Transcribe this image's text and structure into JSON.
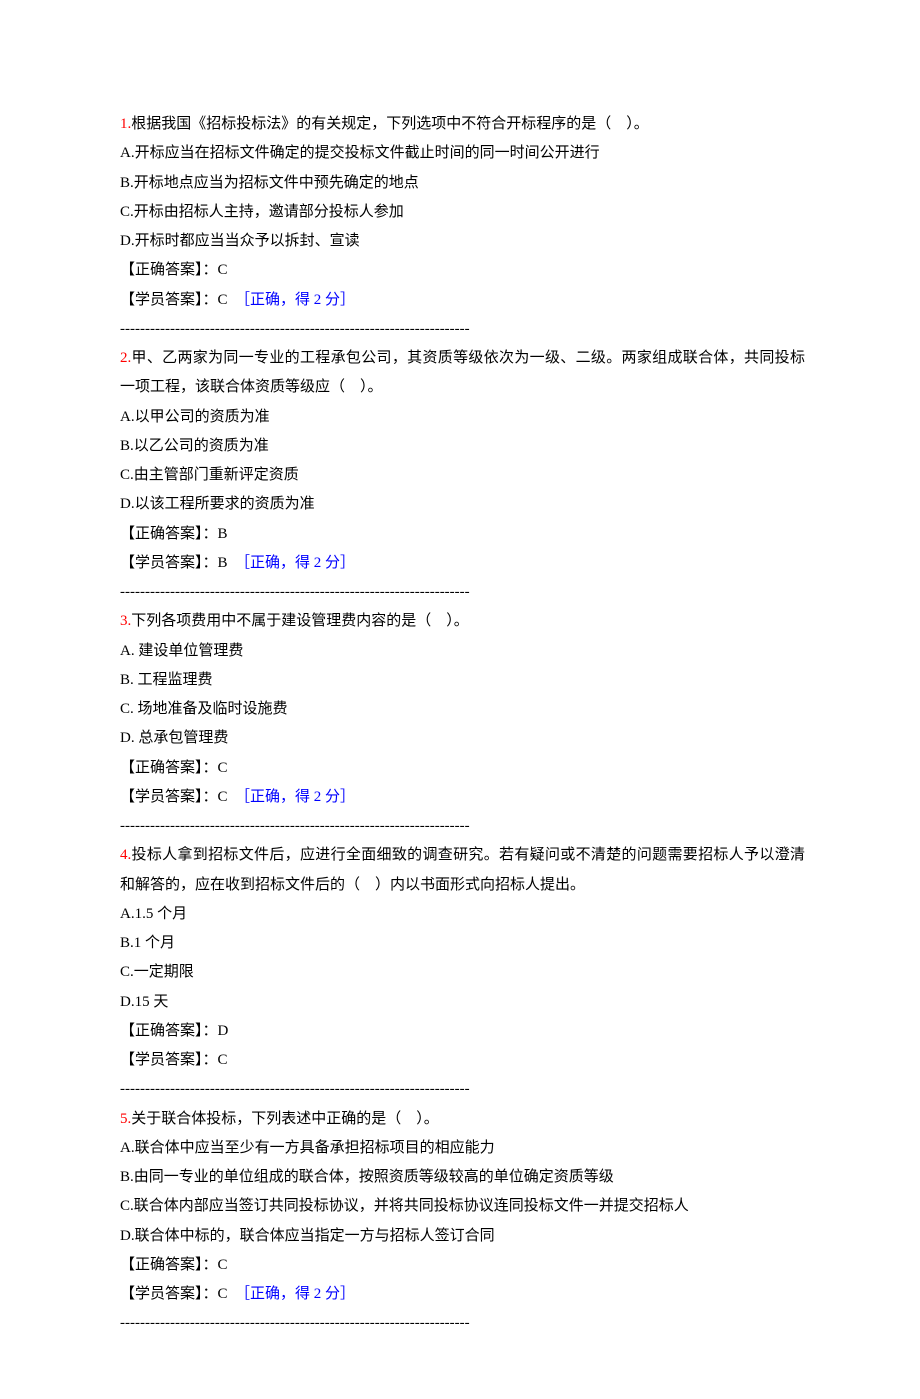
{
  "divider": "----------------------------------------------------------------------",
  "labels": {
    "correct_answer": "【正确答案】：",
    "student_answer": "【学员答案】：",
    "feedback_correct": "［正确，得 2 分］"
  },
  "questions": [
    {
      "num": "1.",
      "stem": "根据我国《招标投标法》的有关规定，下列选项中不符合开标程序的是（　）。",
      "options": [
        "A.开标应当在招标文件确定的提交投标文件截止时间的同一时间公开进行",
        "B.开标地点应当为招标文件中预先确定的地点",
        "C.开标由招标人主持，邀请部分投标人参加",
        "D.开标时都应当当众予以拆封、宣读"
      ],
      "correct": "C",
      "student": "C",
      "has_feedback": true
    },
    {
      "num": "2.",
      "stem": "甲、乙两家为同一专业的工程承包公司，其资质等级依次为一级、二级。两家组成联合体，共同投标一项工程，该联合体资质等级应（　）。",
      "options": [
        "A.以甲公司的资质为准",
        "B.以乙公司的资质为准",
        "C.由主管部门重新评定资质",
        "D.以该工程所要求的资质为准"
      ],
      "correct": "B",
      "student": "B",
      "has_feedback": true
    },
    {
      "num": "3.",
      "stem": "下列各项费用中不属于建设管理费内容的是（　）。",
      "options": [
        "A. 建设单位管理费",
        "B. 工程监理费",
        "C. 场地准备及临时设施费",
        "D. 总承包管理费"
      ],
      "correct": "C",
      "student": "C",
      "has_feedback": true
    },
    {
      "num": "4.",
      "stem": "投标人拿到招标文件后，应进行全面细致的调查研究。若有疑问或不清楚的问题需要招标人予以澄清和解答的，应在收到招标文件后的（　）内以书面形式向招标人提出。",
      "options": [
        "A.1.5 个月",
        "B.1 个月",
        "C.一定期限",
        "D.15 天"
      ],
      "correct": "D",
      "student": "C",
      "has_feedback": false
    },
    {
      "num": "5.",
      "stem": "关于联合体投标，下列表述中正确的是（　）。",
      "options": [
        "A.联合体中应当至少有一方具备承担招标项目的相应能力",
        "B.由同一专业的单位组成的联合体，按照资质等级较高的单位确定资质等级",
        "C.联合体内部应当签订共同投标协议，并将共同投标协议连同投标文件一并提交招标人",
        "D.联合体中标的，联合体应当指定一方与招标人签订合同"
      ],
      "correct": "C",
      "student": "C",
      "has_feedback": true
    }
  ]
}
